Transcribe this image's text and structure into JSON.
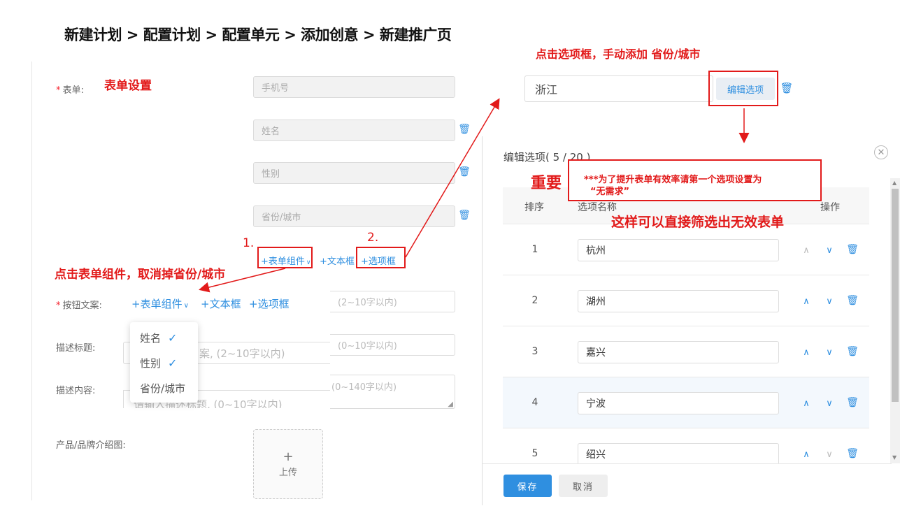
{
  "breadcrumb": "新建计划 > 配置计划 > 配置单元 > 添加创意 > 新建推广页",
  "annotations": {
    "form_settings": "表单设置",
    "step1": "1.",
    "step2": "2.",
    "click_form_component": "点击表单组件，取消掉省份/城市",
    "click_option_box": "点击选项框，手动添加 省份/城市",
    "important": "重要",
    "note_line1": "***为了提升表单有效率请第一个选项设置为",
    "note_line2": "“无需求”",
    "filter_note": "这样可以直接筛选出无效表单"
  },
  "form": {
    "form_label": "表单:",
    "fields": [
      "手机号",
      "姓名",
      "性别",
      "省份/城市"
    ],
    "toolbar_small": {
      "component": "+表单组件",
      "text_box": "+文本框",
      "option_box": "+选项框"
    },
    "button_text_label": "按钮文案:",
    "toolbar_large": {
      "component": "+表单组件",
      "text_box": "+文本框",
      "option_box": "+选项框"
    },
    "button_text_placeholder": "(2~10字以内)",
    "desc_title_label": "描述标题:",
    "desc_title_placeholder_behind": "案, (2~10字以内)",
    "desc_title_placeholder": "(0~10字以内)",
    "desc_content_label": "描述内容:",
    "desc_content_placeholder_behind": "请输入描述标题, (0~10字以内)",
    "desc_content_placeholder": "(0~140字以内)",
    "product_image_label": "产品/品牌介绍图:",
    "upload_plus": "+",
    "upload_label": "上传"
  },
  "dropdown": {
    "items": [
      {
        "label": "姓名",
        "checked": true
      },
      {
        "label": "性别",
        "checked": true
      },
      {
        "label": "省份/城市",
        "checked": false
      }
    ]
  },
  "option_field": {
    "value": "浙江",
    "edit_button": "编辑选项"
  },
  "dialog": {
    "title": "编辑选项( 5 / 20 )",
    "col_order": "排序",
    "col_name": "选项名称",
    "col_action": "操作",
    "rows": [
      {
        "order": "1",
        "name": "杭州"
      },
      {
        "order": "2",
        "name": "湖州"
      },
      {
        "order": "3",
        "name": "嘉兴"
      },
      {
        "order": "4",
        "name": "宁波"
      },
      {
        "order": "5",
        "name": "绍兴"
      }
    ],
    "save": "保存",
    "cancel": "取消"
  },
  "colors": {
    "accent": "#2f8fe0",
    "annotation": "#e21a1a"
  }
}
